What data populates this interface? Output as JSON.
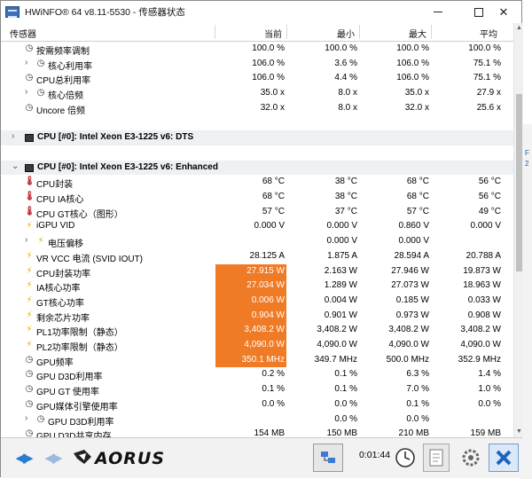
{
  "window": {
    "title": "HWiNFO® 64 v8.11-5530 - 传感器状态"
  },
  "columns": {
    "name": "传感器",
    "current": "当前",
    "min": "最小",
    "max": "最大",
    "avg": "平均"
  },
  "colors": {
    "highlight": "#f07b26",
    "section_bg": "#eef0f3",
    "temp_icon": "#c0242b",
    "volt_icon": "#e0b000"
  },
  "right_peek": {
    "a": "F",
    "b": "2"
  },
  "rows": [
    {
      "name": "按需频率调制",
      "icon": "clock-icon",
      "indent": 1,
      "cur": "100.0 %",
      "min": "100.0 %",
      "max": "100.0 %",
      "avg": "100.0 %"
    },
    {
      "name": "核心利用率",
      "icon": "clock-icon",
      "indent": 2,
      "expander": "collapsed",
      "cur": "106.0 %",
      "min": "3.6 %",
      "max": "106.0 %",
      "avg": "75.1 %"
    },
    {
      "name": "CPU总利用率",
      "icon": "clock-icon",
      "indent": 1,
      "cur": "106.0 %",
      "min": "4.4 %",
      "max": "106.0 %",
      "avg": "75.1 %"
    },
    {
      "name": "核心倍频",
      "icon": "clock-icon",
      "indent": 2,
      "expander": "collapsed",
      "cur": "35.0 x",
      "min": "8.0 x",
      "max": "35.0 x",
      "avg": "27.9 x"
    },
    {
      "name": "Uncore 倍频",
      "icon": "clock-icon",
      "indent": 1,
      "cur": "32.0 x",
      "min": "8.0 x",
      "max": "32.0 x",
      "avg": "25.6 x"
    },
    {
      "type": "blank"
    },
    {
      "type": "section",
      "name": "CPU [#0]: Intel Xeon E3-1225 v6: DTS",
      "expander": "collapsed"
    },
    {
      "type": "blank"
    },
    {
      "type": "section",
      "name": "CPU [#0]: Intel Xeon E3-1225 v6: Enhanced",
      "expander": "expanded"
    },
    {
      "name": "CPU封装",
      "icon": "thermometer-icon",
      "indent": 1,
      "cur": "68 °C",
      "min": "38 °C",
      "max": "68 °C",
      "avg": "56 °C"
    },
    {
      "name": "CPU IA核心",
      "icon": "thermometer-icon",
      "indent": 1,
      "cur": "68 °C",
      "min": "38 °C",
      "max": "68 °C",
      "avg": "56 °C"
    },
    {
      "name": "CPU GT核心（图形）",
      "icon": "thermometer-icon",
      "indent": 1,
      "cur": "57 °C",
      "min": "37 °C",
      "max": "57 °C",
      "avg": "49 °C"
    },
    {
      "name": "iGPU VID",
      "icon": "lightning-icon",
      "indent": 1,
      "cur": "0.000 V",
      "min": "0.000 V",
      "max": "0.860 V",
      "avg": "0.000 V"
    },
    {
      "name": "电压偏移",
      "icon": "lightning-icon",
      "indent": 2,
      "expander": "collapsed",
      "cur": "",
      "min": "0.000 V",
      "max": "0.000 V",
      "avg": ""
    },
    {
      "name": "VR VCC 电流 (SVID IOUT)",
      "icon": "lightning-icon",
      "indent": 1,
      "cur": "28.125 A",
      "min": "1.875 A",
      "max": "28.594 A",
      "avg": "20.788 A"
    },
    {
      "name": "CPU封装功率",
      "icon": "lightning-icon",
      "indent": 1,
      "hl": true,
      "cur": "27.915 W",
      "min": "2.163 W",
      "max": "27.946 W",
      "avg": "19.873 W"
    },
    {
      "name": "IA核心功率",
      "icon": "lightning-icon",
      "indent": 1,
      "hl": true,
      "cur": "27.034 W",
      "min": "1.289 W",
      "max": "27.073 W",
      "avg": "18.963 W"
    },
    {
      "name": "GT核心功率",
      "icon": "lightning-icon",
      "indent": 1,
      "hl": true,
      "cur": "0.006 W",
      "min": "0.004 W",
      "max": "0.185 W",
      "avg": "0.033 W"
    },
    {
      "name": "剩余芯片功率",
      "icon": "lightning-icon",
      "indent": 1,
      "hl": true,
      "cur": "0.904 W",
      "min": "0.901 W",
      "max": "0.973 W",
      "avg": "0.908 W"
    },
    {
      "name": "PL1功率限制（静态）",
      "icon": "lightning-icon",
      "indent": 1,
      "hl": true,
      "cur": "3,408.2 W",
      "min": "3,408.2 W",
      "max": "3,408.2 W",
      "avg": "3,408.2 W"
    },
    {
      "name": "PL2功率限制（静态）",
      "icon": "lightning-icon",
      "indent": 1,
      "hl": true,
      "cur": "4,090.0 W",
      "min": "4,090.0 W",
      "max": "4,090.0 W",
      "avg": "4,090.0 W"
    },
    {
      "name": "GPU频率",
      "icon": "clock-icon",
      "indent": 1,
      "hl": true,
      "cur": "350.1 MHz",
      "min": "349.7 MHz",
      "max": "500.0 MHz",
      "avg": "352.9 MHz"
    },
    {
      "name": "GPU D3D利用率",
      "icon": "clock-icon",
      "indent": 1,
      "cur": "0.2 %",
      "min": "0.1 %",
      "max": "6.3 %",
      "avg": "1.4 %"
    },
    {
      "name": "GPU GT 使用率",
      "icon": "clock-icon",
      "indent": 1,
      "cur": "0.1 %",
      "min": "0.1 %",
      "max": "7.0 %",
      "avg": "1.0 %"
    },
    {
      "name": "GPU媒体引擎使用率",
      "icon": "clock-icon",
      "indent": 1,
      "cur": "0.0 %",
      "min": "0.0 %",
      "max": "0.1 %",
      "avg": "0.0 %"
    },
    {
      "name": "GPU D3D利用率",
      "icon": "clock-icon",
      "indent": 2,
      "expander": "collapsed",
      "cur": "",
      "min": "0.0 %",
      "max": "0.0 %",
      "avg": ""
    },
    {
      "name": "GPU D3D共享内存",
      "icon": "clock-icon",
      "indent": 1,
      "cur": "154 MB",
      "min": "150 MB",
      "max": "210 MB",
      "avg": "159 MB"
    }
  ],
  "toolbar": {
    "elapsed": "0:01:44"
  }
}
